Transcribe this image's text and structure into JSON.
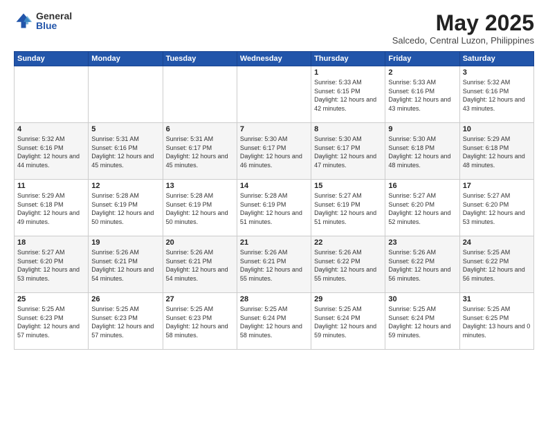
{
  "logo": {
    "general": "General",
    "blue": "Blue"
  },
  "title": "May 2025",
  "subtitle": "Salcedo, Central Luzon, Philippines",
  "days_of_week": [
    "Sunday",
    "Monday",
    "Tuesday",
    "Wednesday",
    "Thursday",
    "Friday",
    "Saturday"
  ],
  "weeks": [
    [
      {
        "day": "",
        "content": ""
      },
      {
        "day": "",
        "content": ""
      },
      {
        "day": "",
        "content": ""
      },
      {
        "day": "",
        "content": ""
      },
      {
        "day": "1",
        "content": "Sunrise: 5:33 AM\nSunset: 6:15 PM\nDaylight: 12 hours\nand 42 minutes."
      },
      {
        "day": "2",
        "content": "Sunrise: 5:33 AM\nSunset: 6:16 PM\nDaylight: 12 hours\nand 43 minutes."
      },
      {
        "day": "3",
        "content": "Sunrise: 5:32 AM\nSunset: 6:16 PM\nDaylight: 12 hours\nand 43 minutes."
      }
    ],
    [
      {
        "day": "4",
        "content": "Sunrise: 5:32 AM\nSunset: 6:16 PM\nDaylight: 12 hours\nand 44 minutes."
      },
      {
        "day": "5",
        "content": "Sunrise: 5:31 AM\nSunset: 6:16 PM\nDaylight: 12 hours\nand 45 minutes."
      },
      {
        "day": "6",
        "content": "Sunrise: 5:31 AM\nSunset: 6:17 PM\nDaylight: 12 hours\nand 45 minutes."
      },
      {
        "day": "7",
        "content": "Sunrise: 5:30 AM\nSunset: 6:17 PM\nDaylight: 12 hours\nand 46 minutes."
      },
      {
        "day": "8",
        "content": "Sunrise: 5:30 AM\nSunset: 6:17 PM\nDaylight: 12 hours\nand 47 minutes."
      },
      {
        "day": "9",
        "content": "Sunrise: 5:30 AM\nSunset: 6:18 PM\nDaylight: 12 hours\nand 48 minutes."
      },
      {
        "day": "10",
        "content": "Sunrise: 5:29 AM\nSunset: 6:18 PM\nDaylight: 12 hours\nand 48 minutes."
      }
    ],
    [
      {
        "day": "11",
        "content": "Sunrise: 5:29 AM\nSunset: 6:18 PM\nDaylight: 12 hours\nand 49 minutes."
      },
      {
        "day": "12",
        "content": "Sunrise: 5:28 AM\nSunset: 6:19 PM\nDaylight: 12 hours\nand 50 minutes."
      },
      {
        "day": "13",
        "content": "Sunrise: 5:28 AM\nSunset: 6:19 PM\nDaylight: 12 hours\nand 50 minutes."
      },
      {
        "day": "14",
        "content": "Sunrise: 5:28 AM\nSunset: 6:19 PM\nDaylight: 12 hours\nand 51 minutes."
      },
      {
        "day": "15",
        "content": "Sunrise: 5:27 AM\nSunset: 6:19 PM\nDaylight: 12 hours\nand 51 minutes."
      },
      {
        "day": "16",
        "content": "Sunrise: 5:27 AM\nSunset: 6:20 PM\nDaylight: 12 hours\nand 52 minutes."
      },
      {
        "day": "17",
        "content": "Sunrise: 5:27 AM\nSunset: 6:20 PM\nDaylight: 12 hours\nand 53 minutes."
      }
    ],
    [
      {
        "day": "18",
        "content": "Sunrise: 5:27 AM\nSunset: 6:20 PM\nDaylight: 12 hours\nand 53 minutes."
      },
      {
        "day": "19",
        "content": "Sunrise: 5:26 AM\nSunset: 6:21 PM\nDaylight: 12 hours\nand 54 minutes."
      },
      {
        "day": "20",
        "content": "Sunrise: 5:26 AM\nSunset: 6:21 PM\nDaylight: 12 hours\nand 54 minutes."
      },
      {
        "day": "21",
        "content": "Sunrise: 5:26 AM\nSunset: 6:21 PM\nDaylight: 12 hours\nand 55 minutes."
      },
      {
        "day": "22",
        "content": "Sunrise: 5:26 AM\nSunset: 6:22 PM\nDaylight: 12 hours\nand 55 minutes."
      },
      {
        "day": "23",
        "content": "Sunrise: 5:26 AM\nSunset: 6:22 PM\nDaylight: 12 hours\nand 56 minutes."
      },
      {
        "day": "24",
        "content": "Sunrise: 5:25 AM\nSunset: 6:22 PM\nDaylight: 12 hours\nand 56 minutes."
      }
    ],
    [
      {
        "day": "25",
        "content": "Sunrise: 5:25 AM\nSunset: 6:23 PM\nDaylight: 12 hours\nand 57 minutes."
      },
      {
        "day": "26",
        "content": "Sunrise: 5:25 AM\nSunset: 6:23 PM\nDaylight: 12 hours\nand 57 minutes."
      },
      {
        "day": "27",
        "content": "Sunrise: 5:25 AM\nSunset: 6:23 PM\nDaylight: 12 hours\nand 58 minutes."
      },
      {
        "day": "28",
        "content": "Sunrise: 5:25 AM\nSunset: 6:24 PM\nDaylight: 12 hours\nand 58 minutes."
      },
      {
        "day": "29",
        "content": "Sunrise: 5:25 AM\nSunset: 6:24 PM\nDaylight: 12 hours\nand 59 minutes."
      },
      {
        "day": "30",
        "content": "Sunrise: 5:25 AM\nSunset: 6:24 PM\nDaylight: 12 hours\nand 59 minutes."
      },
      {
        "day": "31",
        "content": "Sunrise: 5:25 AM\nSunset: 6:25 PM\nDaylight: 13 hours\nand 0 minutes."
      }
    ]
  ]
}
